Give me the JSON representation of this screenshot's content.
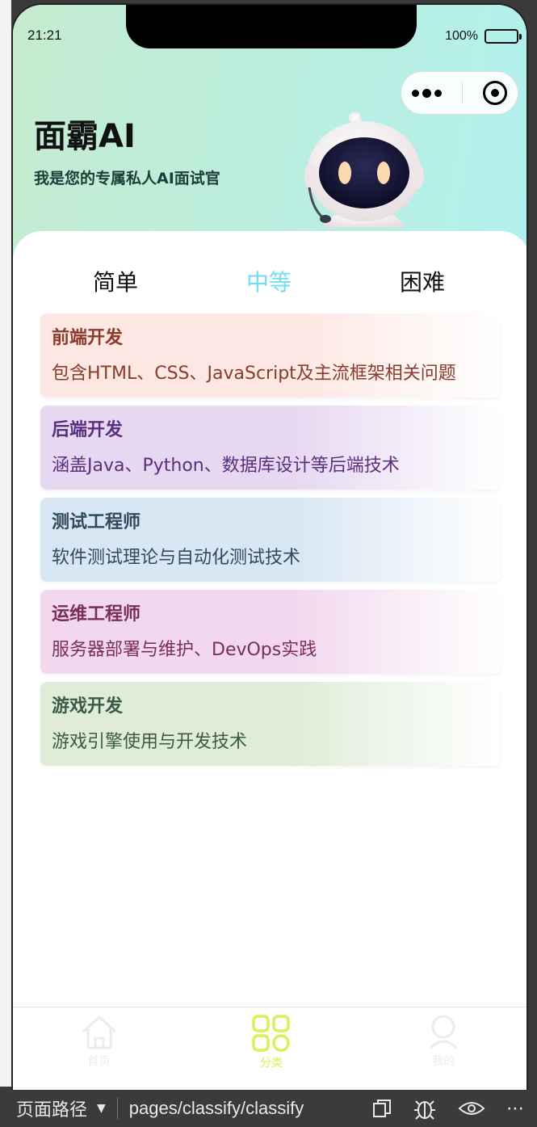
{
  "status": {
    "time": "21:21",
    "battery": "100%"
  },
  "header": {
    "title": "面霸AI",
    "subtitle": "我是您的专属私人AI面试官"
  },
  "tabs": [
    {
      "label": "简单",
      "active": false
    },
    {
      "label": "中等",
      "active": true
    },
    {
      "label": "困难",
      "active": false
    }
  ],
  "categories": [
    {
      "title": "前端开发",
      "desc": "包含HTML、CSS、JavaScript及主流框架相关问题",
      "title_color": "#8a3b2a",
      "desc_color": "#8a3b2a",
      "bg": "#fde7e2"
    },
    {
      "title": "后端开发",
      "desc": "涵盖Java、Python、数据库设计等后端技术",
      "title_color": "#5b2f80",
      "desc_color": "#5b2f80",
      "bg": "#e6d8f1"
    },
    {
      "title": "测试工程师",
      "desc": "软件测试理论与自动化测试技术",
      "title_color": "#2f4a5e",
      "desc_color": "#2f4a5e",
      "bg": "#d8e7f3"
    },
    {
      "title": "运维工程师",
      "desc": "服务器部署与维护、DevOps实践",
      "title_color": "#7a2d5c",
      "desc_color": "#7a2d5c",
      "bg": "#f2d8ee"
    },
    {
      "title": "游戏开发",
      "desc": "游戏引擎使用与开发技术",
      "title_color": "#3b5a48",
      "desc_color": "#3b5a48",
      "bg": "#dfedd8"
    }
  ],
  "tabbar": [
    {
      "label": "首页",
      "icon": "home-icon",
      "active": false
    },
    {
      "label": "分类",
      "icon": "category-grid-icon",
      "active": true
    },
    {
      "label": "我的",
      "icon": "user-icon",
      "active": false
    }
  ],
  "devtools": {
    "path_label": "页面路径",
    "route": "pages/classify/classify"
  },
  "colors": {
    "accent_tab": "#72dfee",
    "tabbar_active": "#d7f25a",
    "hero_gradient_start": "#c5ebcf",
    "hero_gradient_end": "#b2f0ee"
  }
}
